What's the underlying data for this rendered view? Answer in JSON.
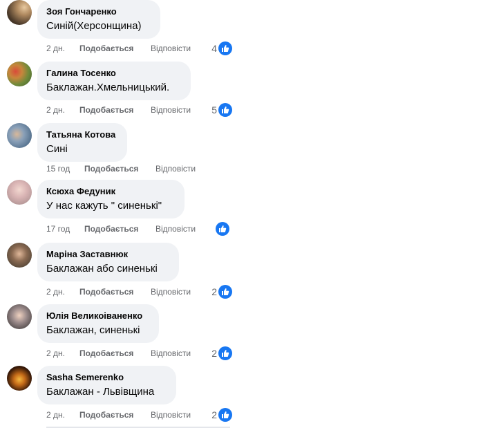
{
  "actions": {
    "like_label": "Подобається",
    "reply_label": "Відповісти"
  },
  "comments": [
    {
      "author": "Зоя Гончаренко",
      "text": "Синій(Херсонщина)",
      "time": "2 дн.",
      "likes": "4"
    },
    {
      "author": "Галина Тосенко",
      "text": "Баклажан.Хмельницький.",
      "time": "2 дн.",
      "likes": "5"
    },
    {
      "author": "Татьяна Котова",
      "text": "Сині",
      "time": "15 год",
      "likes": ""
    },
    {
      "author": "Ксюха Федуник",
      "text": "У нас кажуть \" синенькі\"",
      "time": "17 год",
      "likes": ""
    },
    {
      "author": "Маріна Заставнюк",
      "text": "Баклажан або синенькі",
      "time": "2 дн.",
      "likes": "2"
    },
    {
      "author": "Юлія Великоіваненко",
      "text": "Баклажан, синенькі",
      "time": "2 дн.",
      "likes": "2"
    },
    {
      "author": "Sasha Semerenko",
      "text": "Баклажан - Львівщина",
      "time": "2 дн.",
      "likes": "2"
    }
  ],
  "colors": {
    "like_blue": "#1877f2",
    "bubble_bg": "#f0f2f5",
    "meta_gray": "#65676b"
  }
}
